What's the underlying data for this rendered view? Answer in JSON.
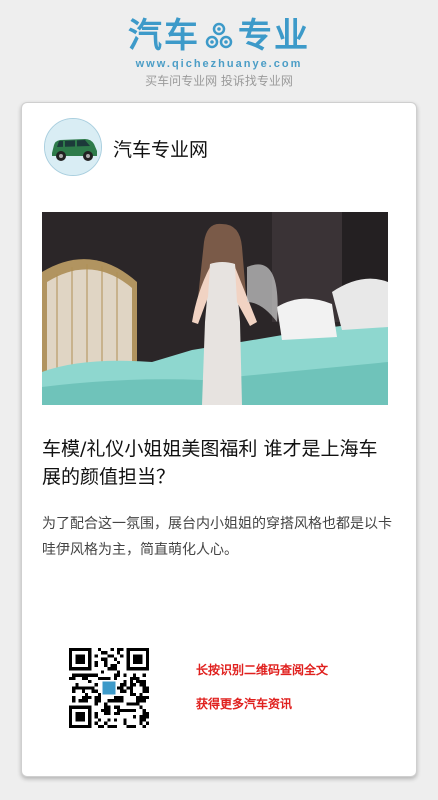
{
  "brand": {
    "name_left": "汽车",
    "name_right": "专业",
    "icon": "gear-icon",
    "url": "www.qichezhuanye.com",
    "slogan": "买车问专业网 投诉找专业网",
    "color": "#3d9ac9"
  },
  "card": {
    "author": "汽车专业网",
    "avatar_icon": "car-icon",
    "title": "车模/礼仪小姐姐美图福利 谁才是上海车展的颜值担当？",
    "summary": "为了配合这一氛围，展台内小姐姐的穿搭风格也都是以卡哇伊风格为主，简直萌化人心。",
    "qr_line1": "长按识别二维码查阅全文",
    "qr_line2": "获得更多汽车资讯",
    "accent_red": "#e0201e"
  }
}
